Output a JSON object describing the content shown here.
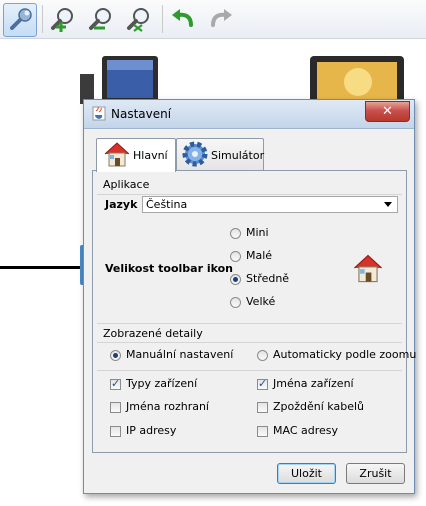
{
  "toolbar": {
    "buttons": [
      {
        "icon": "wrench-icon",
        "selected": true
      },
      {
        "icon": "zoom-in-icon",
        "selected": false
      },
      {
        "icon": "zoom-out-icon",
        "selected": false
      },
      {
        "icon": "zoom-fit-icon",
        "selected": false
      },
      {
        "icon": "undo-icon",
        "selected": false
      },
      {
        "icon": "redo-icon",
        "selected": false
      }
    ]
  },
  "dialog": {
    "title": "Nastavení",
    "tabs": [
      {
        "label": "Hlavní",
        "icon": "house-icon",
        "active": true
      },
      {
        "label": "Simulátor",
        "icon": "gear-icon",
        "active": false
      }
    ],
    "application": {
      "section_label": "Aplikace",
      "language_label": "Jazyk",
      "language_value": "Čeština",
      "toolbar_size_label": "Velikost toolbar ikon",
      "size_options": [
        {
          "label": "Mini",
          "selected": false
        },
        {
          "label": "Malé",
          "selected": false
        },
        {
          "label": "Středně",
          "selected": true
        },
        {
          "label": "Velké",
          "selected": false
        }
      ]
    },
    "details": {
      "section_label": "Zobrazené detaily",
      "mode_options": [
        {
          "label": "Manuální nastavení",
          "selected": true
        },
        {
          "label": "Automaticky podle zoomu",
          "selected": false
        }
      ],
      "checkboxes": [
        {
          "label": "Typy zařízení",
          "checked": true
        },
        {
          "label": "Jména zařízení",
          "checked": true
        },
        {
          "label": "Jména rozhraní",
          "checked": false
        },
        {
          "label": "Zpoždění kabelů",
          "checked": false
        },
        {
          "label": "IP adresy",
          "checked": false
        },
        {
          "label": "MAC adresy",
          "checked": false
        }
      ]
    },
    "buttons": {
      "ok": "Uložit",
      "cancel": "Zrušit"
    }
  }
}
